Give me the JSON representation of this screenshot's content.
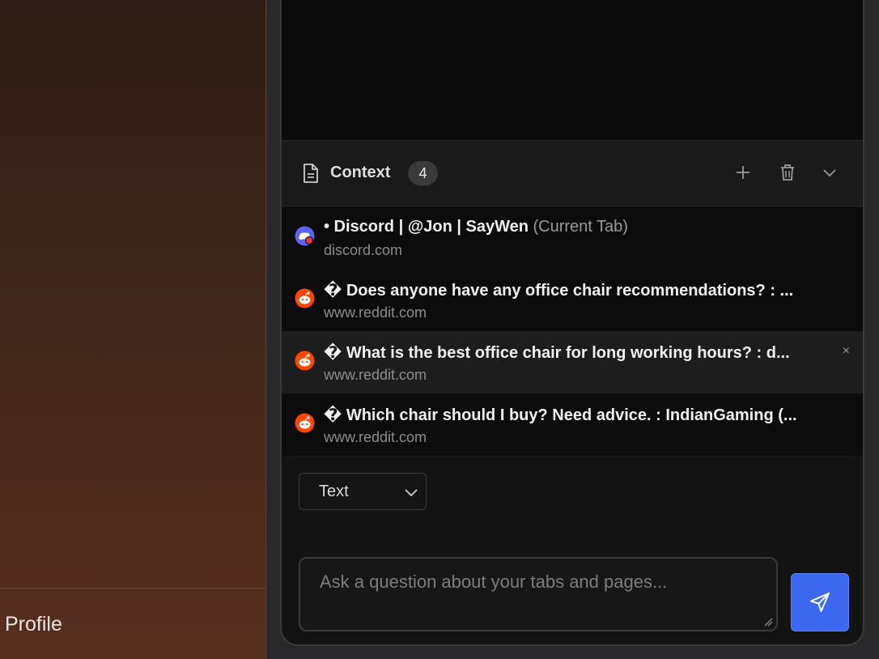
{
  "sidebar": {
    "profile_label": "Profile"
  },
  "context": {
    "title": "Context",
    "count": "4",
    "icons": {
      "doc": "document-icon",
      "add": "plus-icon",
      "clear": "trash-icon",
      "collapse": "chevron-down-icon"
    },
    "items": [
      {
        "favicon": "discord-icon",
        "title": "• Discord | @Jon | SayWen",
        "suffix": " (Current Tab)",
        "url": "discord.com"
      },
      {
        "favicon": "reddit-icon",
        "title": "� Does anyone have any office chair recommendations? : ...",
        "suffix": "",
        "url": "www.reddit.com"
      },
      {
        "favicon": "reddit-icon",
        "title": "� What is the best office chair for long working hours? : d...",
        "suffix": "",
        "url": "www.reddit.com",
        "close": "×"
      },
      {
        "favicon": "reddit-icon",
        "title": "� Which chair should I buy? Need advice. : IndianGaming (...",
        "suffix": "",
        "url": "www.reddit.com"
      }
    ]
  },
  "format_select": {
    "selected": "Text"
  },
  "question": {
    "placeholder": "Ask a question about your tabs and pages..."
  },
  "colors": {
    "accent": "#3b68ee",
    "reddit": "#ff4500",
    "discord": "#5865f2"
  },
  "send_icon": "send-icon"
}
